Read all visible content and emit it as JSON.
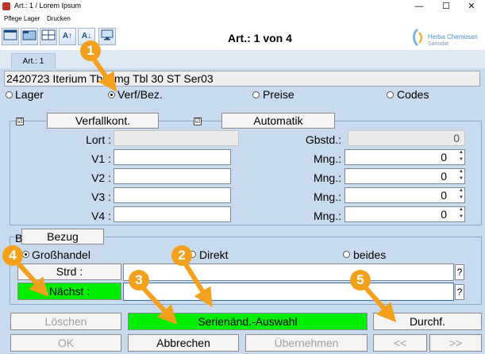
{
  "window": {
    "title": "Art.: 1 / Lorem Ipsum",
    "controls": {
      "minimize": "—",
      "maximize": "☐",
      "close": "✕"
    }
  },
  "menu": {
    "items": [
      "Pflege Lager",
      "Drucken"
    ]
  },
  "toolbar": {
    "icons": [
      "window-cascade-icon",
      "folder-icon",
      "layout-grid-icon",
      "sort-az-up-icon",
      "sort-az-down-icon",
      "monitor-icon"
    ],
    "sort_up_glyph": "A↑",
    "sort_down_glyph": "A↓"
  },
  "header": {
    "record": "Art.: 1 von 4",
    "logo_name": "Herba Chemosan",
    "logo_sub": "Sanodat"
  },
  "tabs": [
    "Art.: 1"
  ],
  "article": {
    "description": "2420723 Iterium Tbl 1mg Tbl 30 ST Ser03"
  },
  "view_radios": {
    "options": [
      "Lager",
      "Verf/Bez.",
      "Preise",
      "Codes"
    ],
    "selected": "Verf/Bez."
  },
  "verf": {
    "check1": "☑",
    "check2": "☑",
    "verfallkont_label": "Verfallkont.",
    "automatik_label": "Automatik",
    "lort_label": "Lort :",
    "gbstd_label": "Gbstd.:",
    "gbstd_value": "0",
    "v_labels": [
      "V1 :",
      "V2 :",
      "V3 :",
      "V4 :"
    ],
    "mng_label": "Mng.:",
    "mng_values": [
      "0",
      "0",
      "0",
      "0"
    ]
  },
  "bezug": {
    "group_label_prefix": "B",
    "tab_label": "Bezug",
    "options": [
      "Großhandel",
      "Direkt",
      "beides"
    ],
    "selected": "Großhandel",
    "strd_label": "Strd :",
    "naechst_label": "Nächst :",
    "help": "?"
  },
  "actions": {
    "loeschen": "Löschen",
    "serienaend": "Serienänd.-Auswahl",
    "durchf": "Durchf.",
    "ok": "OK",
    "abbrechen": "Abbrechen",
    "uebernehmen": "Übernehmen",
    "prev": "<<",
    "next": ">>"
  },
  "callouts": [
    "1",
    "2",
    "3",
    "4",
    "5"
  ],
  "colors": {
    "callout": "#f3a01c",
    "highlight_green": "#00ee00",
    "panel": "#c8dbee"
  }
}
